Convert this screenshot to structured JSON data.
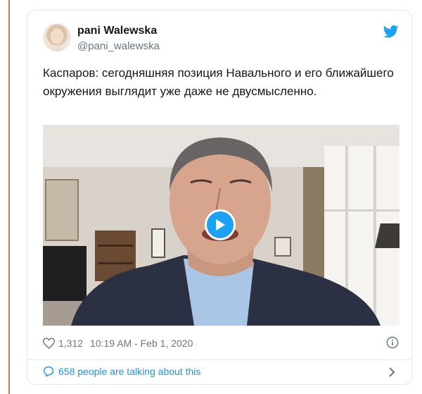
{
  "tweet": {
    "display_name": "pani Walewska",
    "handle": "@pani_walewska",
    "text": "Каспаров: сегодняшняя позиция Навального и его ближайшего окружения выглядит уже даже не двусмысленно.",
    "likes": "1,312",
    "timestamp": "10:19 AM - Feb 1, 2020",
    "conversation_link": "658 people are talking about this"
  },
  "icons": {
    "brand": "twitter-bird-icon",
    "like": "heart-icon",
    "info": "info-icon",
    "conversation": "speech-bubble-icon",
    "chevron": "chevron-right-icon",
    "play": "play-icon"
  },
  "colors": {
    "brand_blue": "#1da1f2",
    "link_blue": "#1b95e0",
    "muted_text": "#657786",
    "border": "#e1e8ed",
    "page_rule": "#c9805d"
  }
}
